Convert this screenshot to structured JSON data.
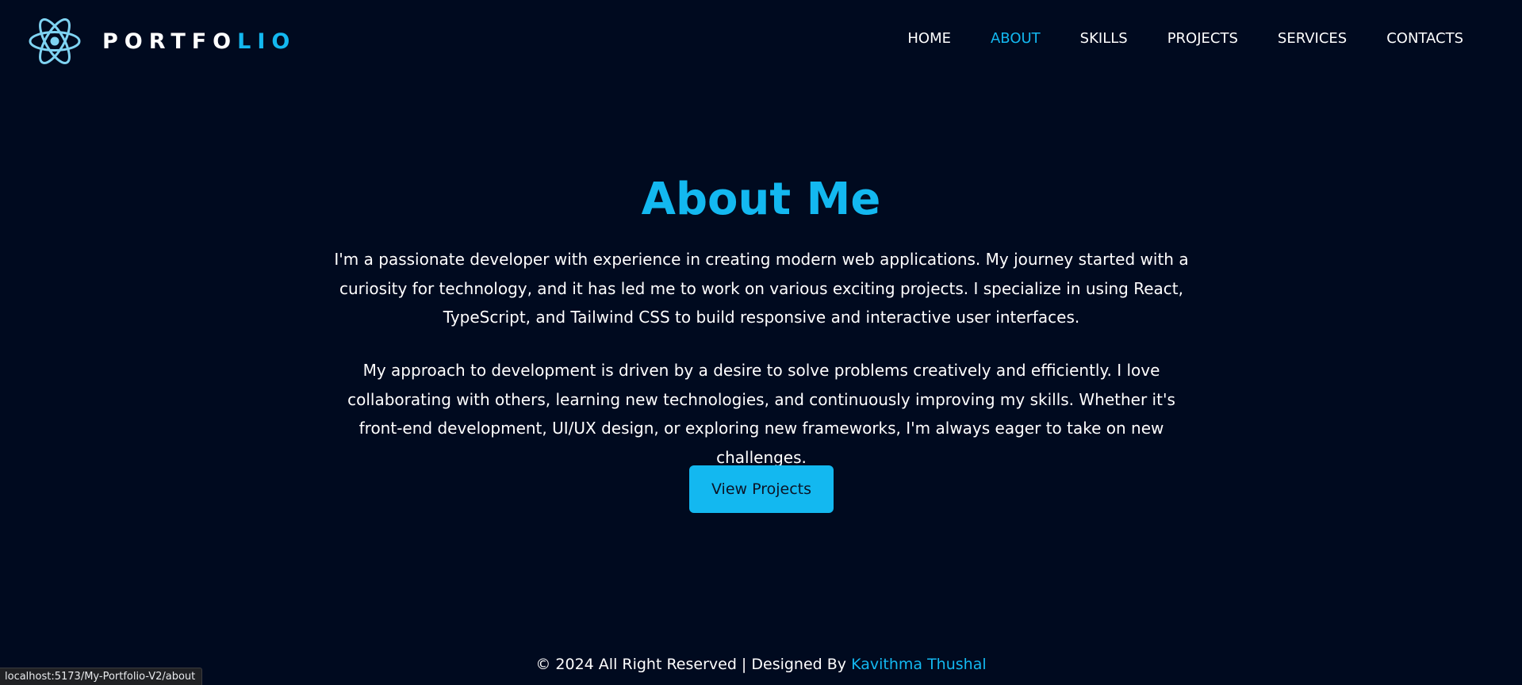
{
  "brand": {
    "logo_icon": "react-atom-icon",
    "name_part1": "PORTFO",
    "name_part2": "LIO"
  },
  "nav": {
    "items": [
      {
        "label": "HOME"
      },
      {
        "label": "ABOUT"
      },
      {
        "label": "SKILLS"
      },
      {
        "label": "PROJECTS"
      },
      {
        "label": "SERVICES"
      },
      {
        "label": "CONTACTS"
      }
    ],
    "active": "ABOUT"
  },
  "about": {
    "title": "About Me",
    "paragraph1": "I'm a passionate developer with experience in creating modern web applications. My journey started with a curiosity for technology, and it has led me to work on various exciting projects. I specialize in using React, TypeScript, and Tailwind CSS to build responsive and interactive user interfaces.",
    "paragraph2": "My approach to development is driven by a desire to solve problems creatively and efficiently. I love collaborating with others, learning new technologies, and continuously improving my skills. Whether it's front-end development, UI/UX design, or exploring new frameworks, I'm always eager to take on new challenges.",
    "cta_label": "View Projects"
  },
  "footer": {
    "text": "© 2024 All Right Reserved | Designed By ",
    "author": "Kavithma Thushal"
  },
  "status_bar": {
    "url": "localhost:5173/My-Portfolio-V2/about"
  },
  "colors": {
    "background": "#000a1f",
    "accent": "#13b8f0",
    "text": "#ffffff"
  }
}
